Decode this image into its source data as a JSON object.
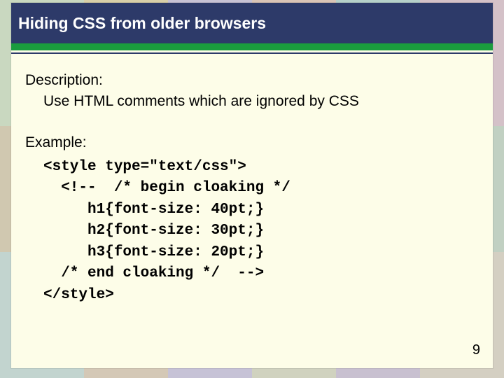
{
  "bg": {
    "rows": [
      [
        "#c9d8c0",
        "#d8cfa8",
        "#c7c2d4",
        "#d9c4b6",
        "#b5d0c9",
        "#d4c1c8"
      ],
      [
        "#d0c8b0",
        "#c0cbd6",
        "#d6c0b3",
        "#c8d4c0",
        "#d2c6d6",
        "#c1d0c2"
      ],
      [
        "#c2d4cf",
        "#d4c8b6",
        "#c6c2d6",
        "#d0d2bf",
        "#c8c0d0",
        "#d4cfc2"
      ]
    ]
  },
  "title": "Hiding CSS from older browsers",
  "descriptionLabel": "Description:",
  "descriptionBody": "Use HTML comments which are ignored by CSS",
  "exampleLabel": "Example:",
  "code": "<style type=\"text/css\">\n  <!--  /* begin cloaking */\n     h1{font-size: 40pt;}\n     h2{font-size: 30pt;}\n     h3{font-size: 20pt;}\n  /* end cloaking */  -->\n</style>",
  "pageNumber": "9"
}
